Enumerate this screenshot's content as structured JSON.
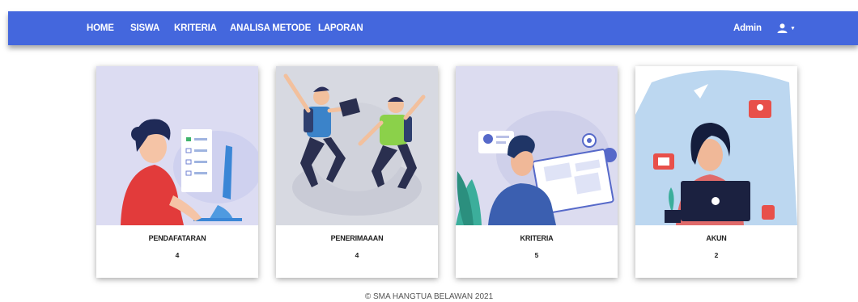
{
  "nav": {
    "links": [
      "HOME",
      "SISWA",
      "KRITERIA",
      "ANALISA METODE",
      "LAPORAN"
    ],
    "user_label": "Admin",
    "user_icon": "user-icon"
  },
  "cards": [
    {
      "title": "PENDAFATARAN",
      "count": "4",
      "illustration": "woman-computer-checklist"
    },
    {
      "title": "PENERIMAAAN",
      "count": "4",
      "illustration": "students-jumping"
    },
    {
      "title": "KRITERIA",
      "count": "5",
      "illustration": "man-web-design"
    },
    {
      "title": "AKUN",
      "count": "2",
      "illustration": "woman-laptop-social"
    }
  ],
  "footer": {
    "text": "© SMA HANGTUA BELAWAN 2021"
  },
  "colors": {
    "navbar": "#4467dd",
    "text_on_nav": "#ffffff"
  }
}
